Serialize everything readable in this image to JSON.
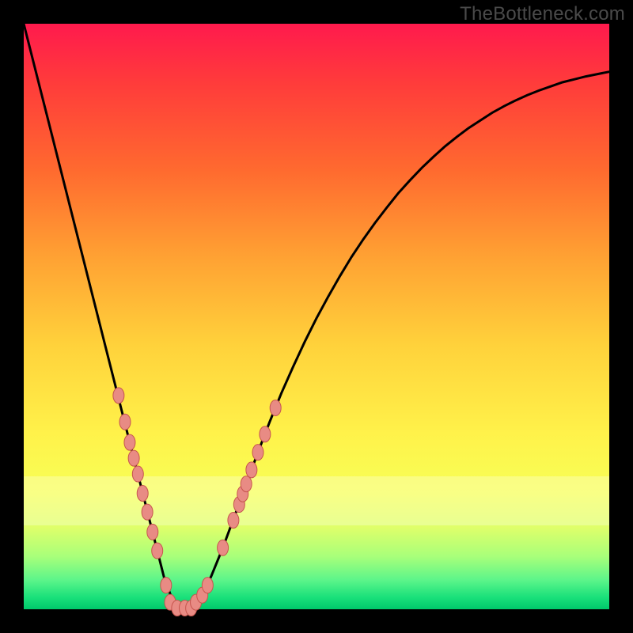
{
  "watermark": {
    "text": "TheBottleneck.com"
  },
  "colors": {
    "curve_stroke": "#000000",
    "marker_fill": "#e88b84",
    "marker_stroke": "#c6554e",
    "frame_bg": "#000000"
  },
  "chart_data": {
    "type": "line",
    "title": "",
    "xlabel": "",
    "ylabel": "",
    "xlim": [
      0,
      100
    ],
    "ylim": [
      0,
      100
    ],
    "grid": false,
    "legend": false,
    "x": [
      0,
      2,
      4,
      6,
      8,
      10,
      12,
      14,
      16,
      18,
      20,
      22,
      24,
      26,
      28,
      30,
      32,
      34,
      36,
      38,
      40,
      42,
      44,
      46,
      48,
      50,
      52,
      54,
      56,
      58,
      60,
      62,
      64,
      66,
      68,
      70,
      72,
      74,
      76,
      78,
      80,
      82,
      84,
      86,
      88,
      90,
      92,
      94,
      96,
      98,
      100
    ],
    "series": [
      {
        "name": "left",
        "values": [
          100,
          92.1,
          84.2,
          76.3,
          68.4,
          60.5,
          52.6,
          44.7,
          36.8,
          28.9,
          21.1,
          13.2,
          5.3,
          0,
          0,
          0,
          0,
          0,
          0,
          0,
          0,
          0,
          0,
          0,
          0,
          0,
          0,
          0,
          0,
          0,
          0,
          0,
          0,
          0,
          0,
          0,
          0,
          0,
          0,
          0,
          0,
          0,
          0,
          0,
          0,
          0,
          0,
          0,
          0,
          0,
          0
        ]
      },
      {
        "name": "right",
        "values": [
          0,
          0,
          0,
          0,
          0,
          0,
          0,
          0,
          0,
          0,
          0,
          0,
          0,
          0.0,
          0.0,
          1.8,
          5.6,
          10.5,
          15.9,
          21.4,
          26.8,
          32.0,
          36.9,
          41.4,
          45.7,
          49.7,
          53.4,
          56.9,
          60.2,
          63.2,
          66.0,
          68.6,
          71.1,
          73.3,
          75.4,
          77.3,
          79.1,
          80.7,
          82.2,
          83.5,
          84.8,
          85.9,
          86.9,
          87.8,
          88.6,
          89.3,
          90.0,
          90.5,
          91.0,
          91.4,
          91.8
        ]
      }
    ],
    "markers": {
      "name": "highlighted-points",
      "points": [
        {
          "x": 16.2,
          "y": 36.5
        },
        {
          "x": 17.3,
          "y": 32.0
        },
        {
          "x": 18.1,
          "y": 28.5
        },
        {
          "x": 18.8,
          "y": 25.8
        },
        {
          "x": 19.5,
          "y": 23.1
        },
        {
          "x": 20.3,
          "y": 19.8
        },
        {
          "x": 21.1,
          "y": 16.6
        },
        {
          "x": 22.0,
          "y": 13.2
        },
        {
          "x": 22.8,
          "y": 10.0
        },
        {
          "x": 24.3,
          "y": 4.1
        },
        {
          "x": 25.0,
          "y": 1.2
        },
        {
          "x": 26.2,
          "y": 0.2
        },
        {
          "x": 27.5,
          "y": 0.2
        },
        {
          "x": 28.6,
          "y": 0.2
        },
        {
          "x": 29.4,
          "y": 1.2
        },
        {
          "x": 30.5,
          "y": 2.4
        },
        {
          "x": 31.4,
          "y": 4.1
        },
        {
          "x": 34.0,
          "y": 10.5
        },
        {
          "x": 35.8,
          "y": 15.2
        },
        {
          "x": 36.8,
          "y": 17.9
        },
        {
          "x": 37.4,
          "y": 19.7
        },
        {
          "x": 38.0,
          "y": 21.4
        },
        {
          "x": 38.9,
          "y": 23.8
        },
        {
          "x": 40.0,
          "y": 26.8
        },
        {
          "x": 41.2,
          "y": 29.9
        },
        {
          "x": 43.0,
          "y": 34.4
        }
      ]
    }
  }
}
